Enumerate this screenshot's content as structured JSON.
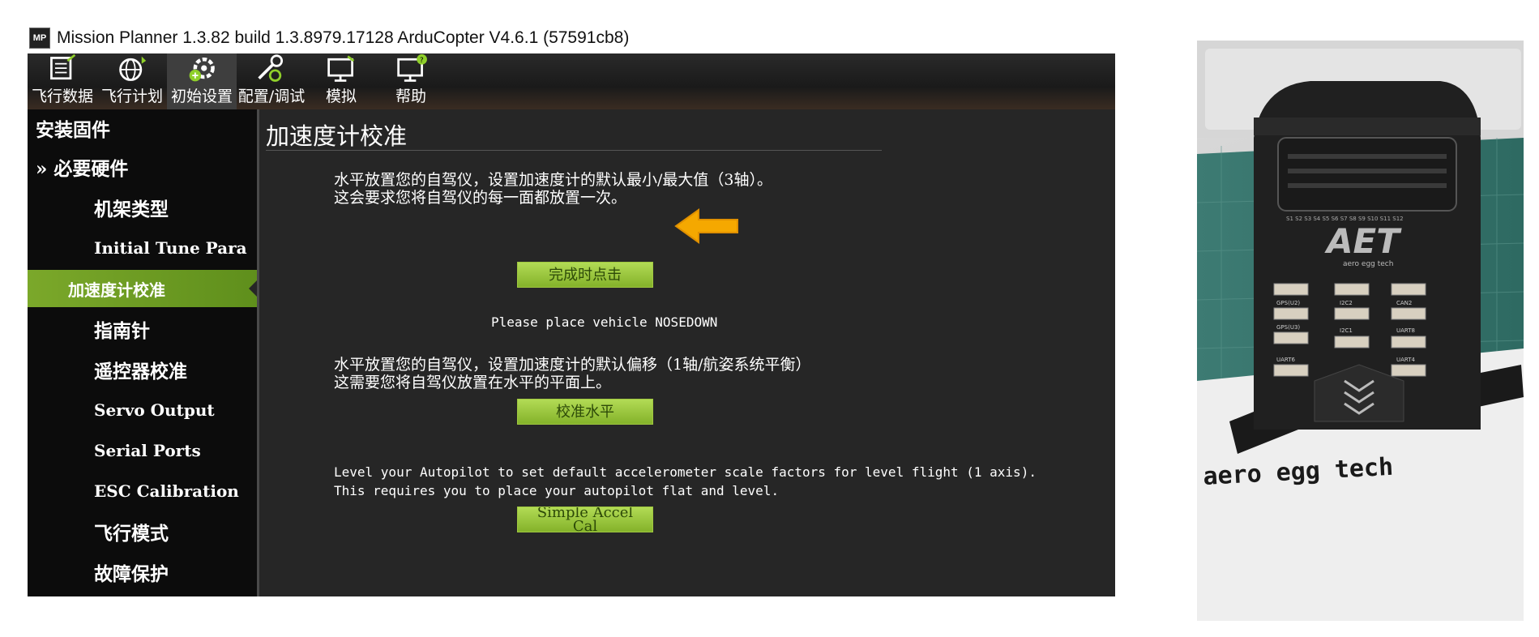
{
  "window": {
    "logo": "MP",
    "title": "Mission Planner 1.3.82 build 1.3.8979.17128 ArduCopter V4.6.1 (57591cb8)"
  },
  "toolbar": {
    "items": [
      {
        "label": "飞行数据",
        "icon": "flight-data-icon"
      },
      {
        "label": "飞行计划",
        "icon": "flight-plan-icon"
      },
      {
        "label": "初始设置",
        "icon": "initial-setup-icon",
        "active": true
      },
      {
        "label": "配置/调试",
        "icon": "config-tuning-icon"
      },
      {
        "label": "模拟",
        "icon": "simulation-icon"
      },
      {
        "label": "帮助",
        "icon": "help-icon"
      }
    ]
  },
  "sidebar": {
    "items": [
      {
        "label": "安装固件"
      },
      {
        "label": "» 必要硬件"
      },
      {
        "label": "机架类型"
      },
      {
        "label": "Initial Tune Para"
      },
      {
        "label": "加速度计校准",
        "active": true
      },
      {
        "label": "指南针"
      },
      {
        "label": "遥控器校准"
      },
      {
        "label": "Servo Output"
      },
      {
        "label": "Serial Ports"
      },
      {
        "label": "ESC Calibration"
      },
      {
        "label": "飞行模式"
      },
      {
        "label": "故障保护"
      }
    ]
  },
  "main": {
    "title": "加速度计校准",
    "section1": {
      "line1": "水平放置您的自驾仪，设置加速度计的默认最小/最大值（3轴）。",
      "line2": "这会要求您将自驾仪的每一面都放置一次。",
      "button": "完成时点击"
    },
    "status": "Please place vehicle NOSEDOWN",
    "section2": {
      "line1": "水平放置您的自驾仪，设置加速度计的默认偏移（1轴/航姿系统平衡）",
      "line2": "这需要您将自驾仪放置在水平的平面上。",
      "button": "校准水平"
    },
    "section3": {
      "line1": "Level your Autopilot to set default accelerometer scale factors for level flight (1 axis).",
      "line2": "This requires you to place your autopilot flat and level.",
      "button_line1": "Simple Accel",
      "button_line2": "Cal"
    }
  },
  "photo": {
    "brand": "AET",
    "brand_sub": "aero egg tech",
    "base_text": "aero egg tech",
    "servo_labels": "S1 S2 S3 S4 S5 S6 S7 S8 S9 S10 S11 S12",
    "ports": [
      "GPS(U2)",
      "I2C2",
      "CAN2",
      "GPS(U3)",
      "I2C1",
      "UART8",
      "UART6",
      "UART4"
    ]
  },
  "colors": {
    "accent_green": "#7ba82a",
    "arrow": "#f5a800",
    "bg_dark": "#262626"
  }
}
